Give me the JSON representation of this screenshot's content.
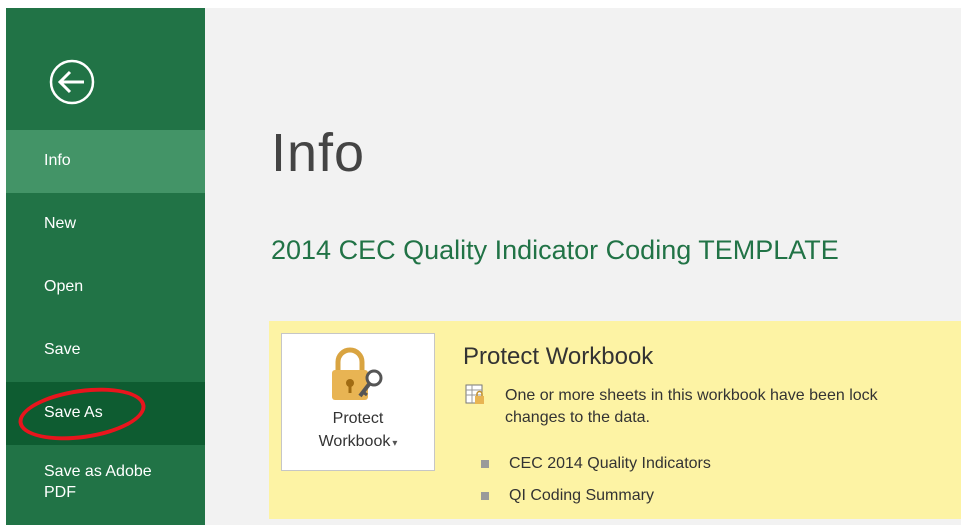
{
  "sidebar": {
    "back_label": "Back",
    "items": [
      {
        "label": "Info"
      },
      {
        "label": "New"
      },
      {
        "label": "Open"
      },
      {
        "label": "Save"
      },
      {
        "label": "Save As"
      },
      {
        "label": "Save as Adobe\nPDF"
      }
    ]
  },
  "main": {
    "title": "Info",
    "document_name": "2014 CEC Quality Indicator Coding TEMPLATE",
    "protect": {
      "button_line1": "Protect",
      "button_line2": "Workbook",
      "section_title": "Protect Workbook",
      "status_line1": "One or more sheets in this workbook have been lock",
      "status_line2": "changes to the data.",
      "sheets": [
        "CEC 2014 Quality Indicators",
        "QI Coding Summary"
      ]
    }
  },
  "colors": {
    "sidebar_bg": "#217346",
    "sidebar_active": "#439467",
    "sidebar_hover": "#0e5c31",
    "accent_text": "#217346",
    "warning_panel": "#fdf3a4",
    "annotation_oval": "#e8151d"
  },
  "icons": [
    "back-arrow-icon",
    "lock-key-icon",
    "locked-sheet-icon",
    "bullet-icon"
  ]
}
